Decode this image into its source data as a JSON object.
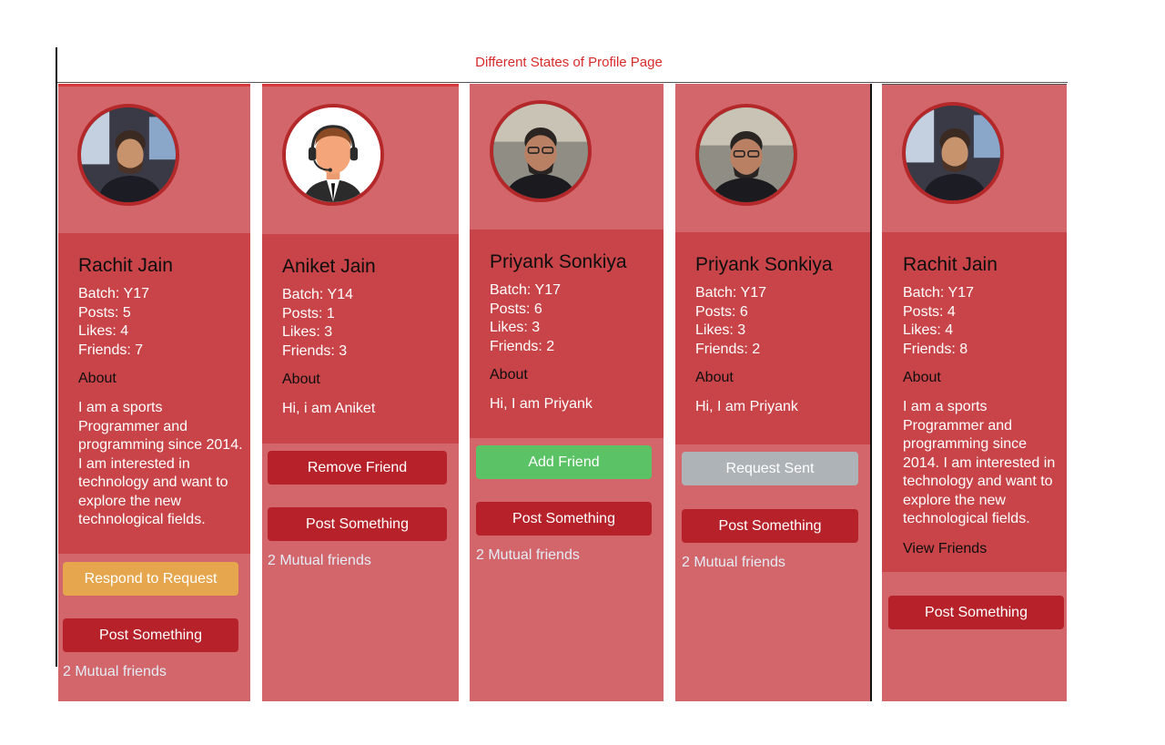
{
  "page_title": "Different States of Profile Page",
  "colors": {
    "title": "#d92b2b",
    "card_bg": "#d3666b",
    "info_bg": "#c84448",
    "button_dark": "#b7222a",
    "button_yellow": "#e5a64d",
    "button_green": "#5bc266",
    "button_gray": "#aeb3b7"
  },
  "cards": [
    {
      "avatar": "photo-avatar",
      "name": "Rachit Jain",
      "batch": "Batch: Y17",
      "posts": "Posts: 5",
      "likes": "Likes: 4",
      "friends": "Friends: 7",
      "about_label": "About",
      "bio": "I am a sports Programmer and programming since 2014. I am interested in technology and want to explore the new technological fields.",
      "action_label": "Respond to Request",
      "post_label": "Post Something",
      "mutual": "2 Mutual friends"
    },
    {
      "avatar": "headset-avatar-icon",
      "name": "Aniket Jain",
      "batch": "Batch: Y14",
      "posts": "Posts: 1",
      "likes": "Likes: 3",
      "friends": "Friends: 3",
      "about_label": "About",
      "bio": "Hi, i am Aniket",
      "action_label": "Remove Friend",
      "post_label": "Post Something",
      "mutual": "2 Mutual friends"
    },
    {
      "avatar": "photo-avatar",
      "name": "Priyank Sonkiya",
      "batch": "Batch: Y17",
      "posts": "Posts: 6",
      "likes": "Likes: 3",
      "friends": "Friends: 2",
      "about_label": "About",
      "bio": "Hi, I am Priyank",
      "action_label": "Add Friend",
      "post_label": "Post Something",
      "mutual": "2 Mutual friends"
    },
    {
      "avatar": "photo-avatar",
      "name": "Priyank Sonkiya",
      "batch": "Batch: Y17",
      "posts": "Posts: 6",
      "likes": "Likes: 3",
      "friends": "Friends: 2",
      "about_label": "About",
      "bio": "Hi, I am Priyank",
      "action_label": "Request Sent",
      "post_label": "Post Something",
      "mutual": "2 Mutual friends"
    },
    {
      "avatar": "photo-avatar",
      "name": "Rachit Jain",
      "batch": "Batch: Y17",
      "posts": "Posts: 4",
      "likes": "Likes: 4",
      "friends": "Friends: 8",
      "about_label": "About",
      "bio": "I am a sports Programmer and programming since 2014. I am interested in technology and want to explore the new technological fields.",
      "view_friends": "View Friends",
      "post_label": "Post Something"
    }
  ]
}
